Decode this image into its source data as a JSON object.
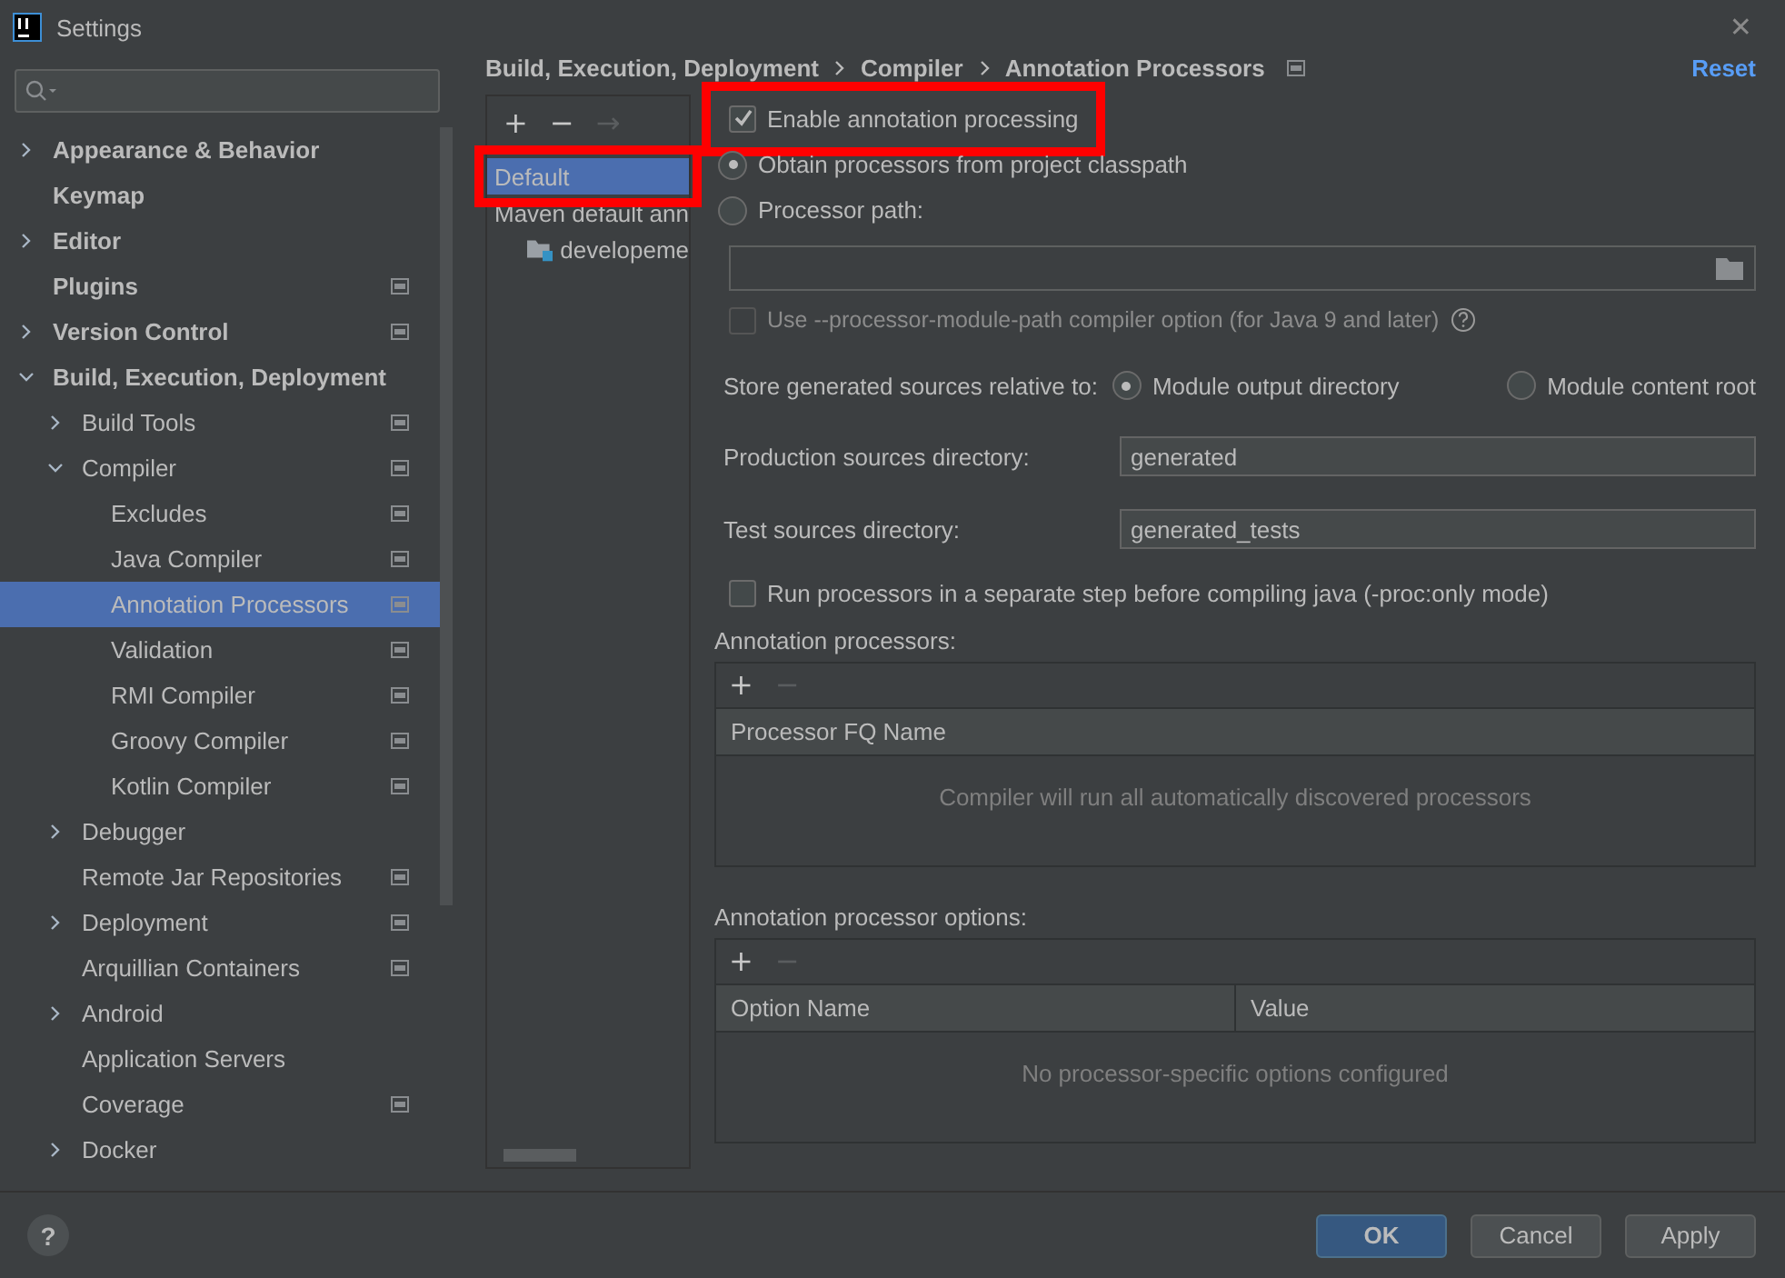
{
  "window": {
    "title": "Settings",
    "close": "✕"
  },
  "sidebar": {
    "items": [
      {
        "label": "Appearance & Behavior",
        "expanded": false,
        "project_level": false
      },
      {
        "label": "Keymap",
        "project_level": false
      },
      {
        "label": "Editor",
        "expanded": false,
        "project_level": false
      },
      {
        "label": "Plugins",
        "project_level": true
      },
      {
        "label": "Version Control",
        "expanded": false,
        "project_level": true
      },
      {
        "label": "Build, Execution, Deployment",
        "expanded": true,
        "project_level": false,
        "children": [
          {
            "label": "Build Tools",
            "expanded": false,
            "project_level": true
          },
          {
            "label": "Compiler",
            "expanded": true,
            "project_level": true,
            "children": [
              {
                "label": "Excludes",
                "project_level": true,
                "selected": false
              },
              {
                "label": "Java Compiler",
                "project_level": true,
                "selected": false
              },
              {
                "label": "Annotation Processors",
                "project_level": true,
                "selected": true
              },
              {
                "label": "Validation",
                "project_level": true,
                "selected": false
              },
              {
                "label": "RMI Compiler",
                "project_level": true,
                "selected": false
              },
              {
                "label": "Groovy Compiler",
                "project_level": true,
                "selected": false
              },
              {
                "label": "Kotlin Compiler",
                "project_level": true,
                "selected": false
              }
            ]
          },
          {
            "label": "Debugger",
            "expanded": false,
            "project_level": false
          },
          {
            "label": "Remote Jar Repositories",
            "project_level": true
          },
          {
            "label": "Deployment",
            "expanded": false,
            "project_level": true
          },
          {
            "label": "Arquillian Containers",
            "project_level": true
          },
          {
            "label": "Android",
            "expanded": false,
            "project_level": false
          },
          {
            "label": "Application Servers",
            "project_level": false
          },
          {
            "label": "Coverage",
            "project_level": true
          },
          {
            "label": "Docker",
            "expanded": false,
            "project_level": false
          }
        ]
      }
    ]
  },
  "breadcrumb": [
    "Build, Execution, Deployment",
    "Compiler",
    "Annotation Processors"
  ],
  "reset_link": "Reset",
  "profiles": {
    "toolbar": [
      {
        "label": "+",
        "disabled": false
      },
      {
        "label": "−",
        "disabled": false
      },
      {
        "label": "→",
        "disabled": true
      }
    ],
    "items": [
      {
        "label": "Default",
        "selected": true,
        "highlighted": true
      },
      {
        "label": "Maven default ann",
        "selected": false,
        "highlighted": false,
        "children": [
          {
            "label": "developeme",
            "selected": false,
            "highlighted": false
          }
        ]
      }
    ]
  },
  "enable_processing": {
    "label": "Enable annotation processing",
    "checked": true,
    "highlighted": true
  },
  "processor_source": [
    {
      "label": "Obtain processors from project classpath",
      "selected": true
    },
    {
      "label": "Processor path:",
      "selected": false
    }
  ],
  "module_path_option": {
    "label": "Use --processor-module-path compiler option (for Java 9 and later)",
    "checked": false,
    "disabled": true
  },
  "store_relative": {
    "label": "Store generated sources relative to:",
    "options": [
      {
        "label": "Module output directory",
        "selected": true
      },
      {
        "label": "Module content root",
        "selected": false
      }
    ]
  },
  "fields": [
    {
      "label": "Production sources directory:",
      "value": "generated"
    },
    {
      "label": "Test sources directory:",
      "value": "generated_tests"
    }
  ],
  "run_separate": {
    "label": "Run processors in a separate step before compiling java (-proc:only mode)",
    "checked": false
  },
  "processors_table": {
    "title": "Annotation processors:",
    "toolbar": [
      {
        "label": "+",
        "disabled": false
      },
      {
        "label": "−",
        "disabled": true
      }
    ],
    "columns": [
      "Processor FQ Name"
    ],
    "empty_text": "Compiler will run all automatically discovered processors"
  },
  "options_table": {
    "title": "Annotation processor options:",
    "toolbar": [
      {
        "label": "+",
        "disabled": false
      },
      {
        "label": "−",
        "disabled": true
      }
    ],
    "columns": [
      "Option Name",
      "Value"
    ],
    "empty_text": "No processor-specific options configured"
  },
  "help_button": "?",
  "buttons": [
    {
      "label": "OK",
      "kind": "primary"
    },
    {
      "label": "Cancel",
      "kind": "normal"
    },
    {
      "label": "Apply",
      "kind": "normal"
    }
  ]
}
